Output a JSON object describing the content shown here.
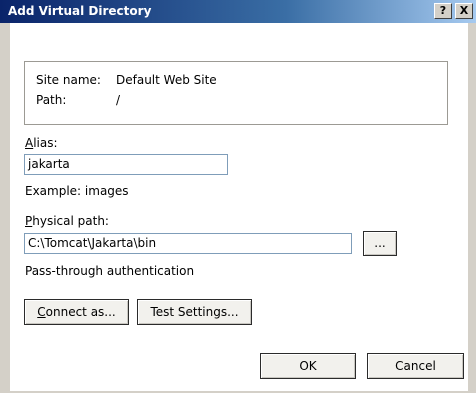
{
  "window": {
    "title": "Add Virtual Directory",
    "help_label": "?",
    "close_label": "X"
  },
  "site": {
    "site_name_label": "Site name:",
    "site_name_value": "Default Web Site",
    "path_label": "Path:",
    "path_value": "/"
  },
  "alias": {
    "label_mnemonic": "A",
    "label_rest": "lias:",
    "value": "jakarta",
    "example": "Example: images"
  },
  "physical_path": {
    "label_mnemonic": "P",
    "label_rest": "hysical path:",
    "value": "C:\\Tomcat\\Jakarta\\bin",
    "browse_label": "...",
    "auth_text": "Pass-through authentication"
  },
  "buttons": {
    "connect_as_mnemonic": "C",
    "connect_as_rest": "onnect as...",
    "test_settings_label": "Test Settings...",
    "ok_label": "OK",
    "cancel_label": "Cancel"
  }
}
